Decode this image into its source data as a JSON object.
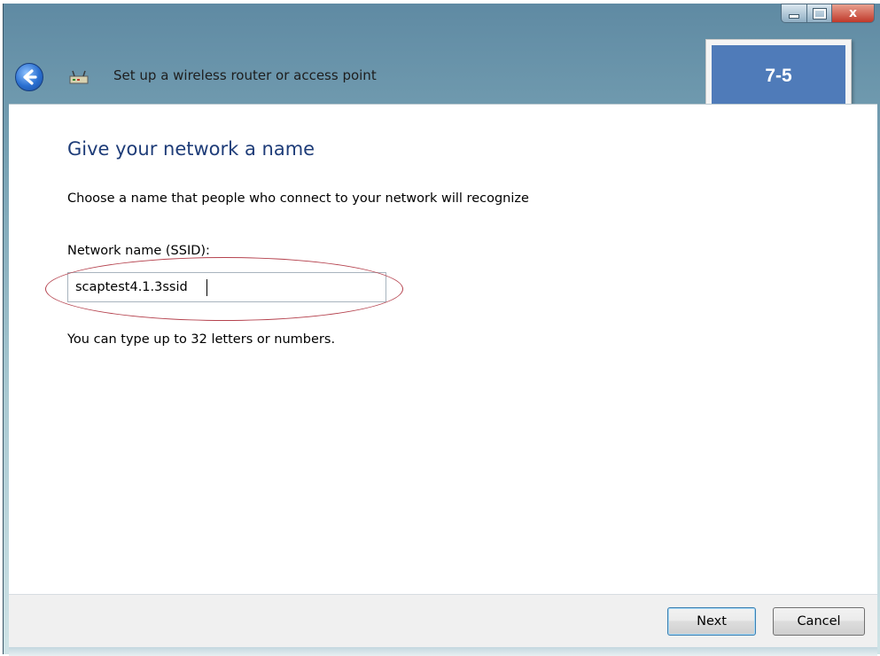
{
  "window": {
    "title": "Set up a wireless router or access point",
    "controls": {
      "minimize": "minimize",
      "maximize": "maximize",
      "close": "x"
    }
  },
  "step_badge": {
    "text": "7-5",
    "color": "#4f7bb9"
  },
  "content": {
    "heading": "Give your network a name",
    "description": "Choose a name that people who connect to your network will recognize",
    "field_label": "Network name (SSID):",
    "ssid_value": "scaptest4.1.3ssid",
    "hint": "You can type up to 32 letters or numbers."
  },
  "footer": {
    "next_label": "Next",
    "cancel_label": "Cancel"
  },
  "colors": {
    "heading": "#1e3c78",
    "annotation": "#b5424e"
  },
  "icons": {
    "back": "back-arrow-icon",
    "app": "network-router-icon",
    "close": "close-icon",
    "minimize": "minimize-icon",
    "maximize": "maximize-icon"
  }
}
